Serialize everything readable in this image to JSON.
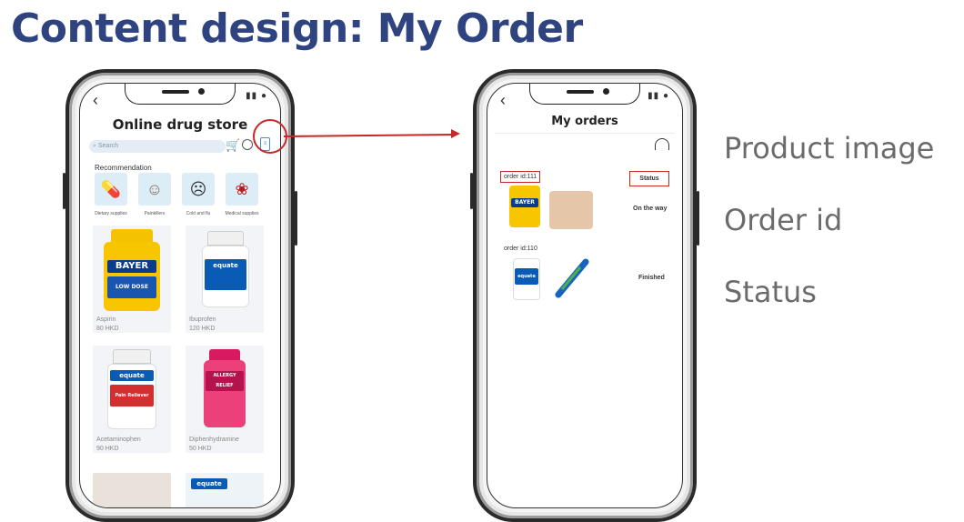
{
  "slide": {
    "title": "Content design: My Order"
  },
  "left_phone": {
    "app_title": "Online drug store",
    "search_placeholder": "Search",
    "recommendation_title": "Recommendation",
    "categories": [
      {
        "label": "Dietary supplies",
        "icon": "pill-icon"
      },
      {
        "label": "Painkillers",
        "icon": "person-icon"
      },
      {
        "label": "Cold and flu",
        "icon": "stethoscope-icon"
      },
      {
        "label": "Medical supplies",
        "icon": "mask-icon"
      }
    ],
    "products": [
      {
        "name": "Aspirin",
        "price": "80 HKD",
        "brand": "BAYER",
        "brand_color": "#0b3c8c",
        "cap_color": "#f5c200",
        "label_color": "#1a56b0"
      },
      {
        "name": "Ibuprofen",
        "price": "120 HKD",
        "brand": "equate",
        "brand_color": "#0a5bb5",
        "cap_color": "#ffffff",
        "label_color": "#0a5bb5"
      },
      {
        "name": "Acetaminophen",
        "price": "90 HKD",
        "brand": "equate",
        "brand_color": "#0a5bb5",
        "cap_color": "#ffffff",
        "label_color": "#d32f2f"
      },
      {
        "name": "Diphenhydramine",
        "price": "50 HKD",
        "brand": "ALLERGY RELIEF",
        "brand_color": "#b5134d",
        "cap_color": "#d81b60",
        "label_color": "#e91e63"
      }
    ],
    "partial_products": [
      {
        "brand": "equate"
      }
    ]
  },
  "right_phone": {
    "title": "My orders",
    "orders": [
      {
        "order_id": "order id:111",
        "status": "On the way",
        "status_header": "Status"
      },
      {
        "order_id": "order id:110",
        "status": "Finished"
      }
    ]
  },
  "annotations": [
    "Product image",
    "Order id",
    "Status"
  ],
  "colors": {
    "title": "#2e4380",
    "highlight": "#c62828",
    "annotation": "#6b6b6b"
  }
}
